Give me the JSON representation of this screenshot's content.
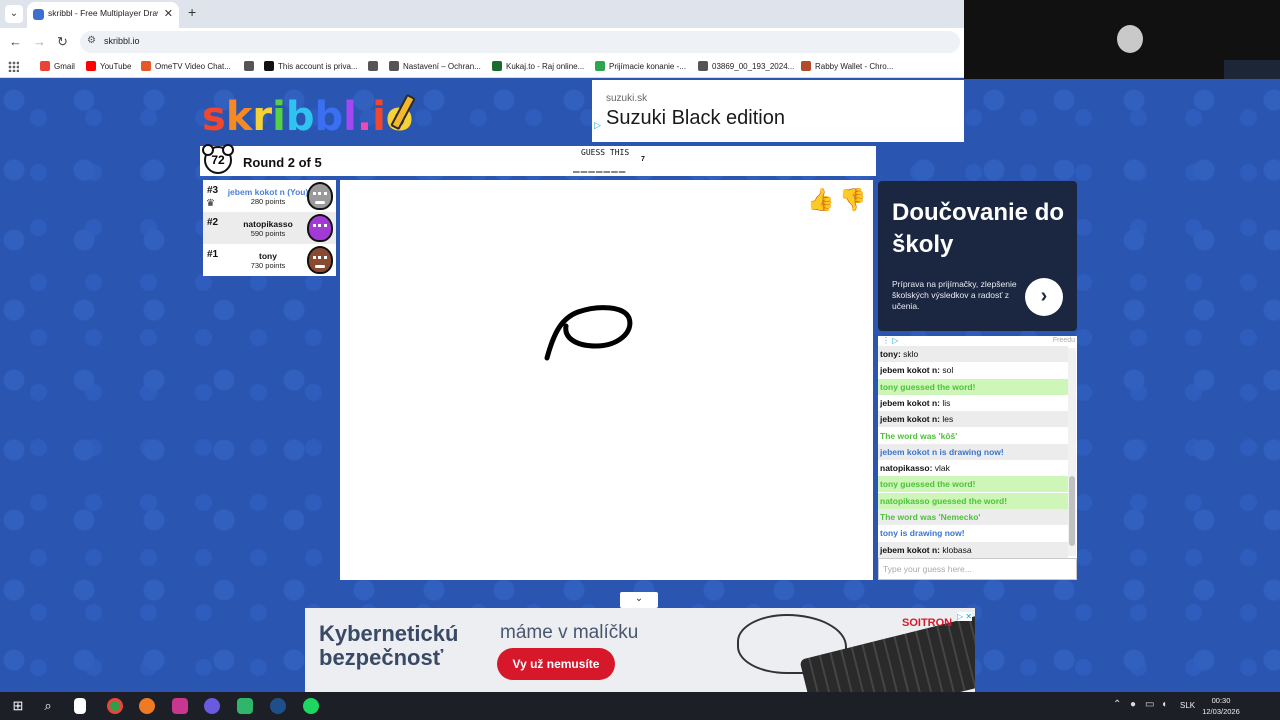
{
  "browser": {
    "tab_title": "skribbl - Free Multiplayer Drawi",
    "url": "skribbl.io",
    "bookmarks": [
      {
        "label": "Gmail",
        "color": "#ea4335"
      },
      {
        "label": "YouTube",
        "color": "#ff0000"
      },
      {
        "label": "OmeTV Video Chat...",
        "color": "#e8572a"
      },
      {
        "label": "",
        "color": "#555555"
      },
      {
        "label": "This account is priva...",
        "color": "#111111"
      },
      {
        "label": "",
        "color": "#555555"
      },
      {
        "label": "Nastavení – Ochran...",
        "color": "#555555"
      },
      {
        "label": "Kukaj.to - Raj online...",
        "color": "#1b6b2f"
      },
      {
        "label": "Prijímacie konanie -...",
        "color": "#2ea44f"
      },
      {
        "label": "03869_00_193_2024...",
        "color": "#555555"
      },
      {
        "label": "Rabby Wallet - Chro...",
        "color": "#b44a2a"
      }
    ]
  },
  "top_ad": {
    "source": "suzuki.sk",
    "headline": "Suzuki Black edition"
  },
  "game": {
    "logo": "skribbl.io",
    "timer": "72",
    "round": "Round 2 of 5",
    "guess_label": "GUESS THIS",
    "word_pattern": "_______",
    "word_length": "7"
  },
  "players": [
    {
      "rank": "#3",
      "name": "jebem kokot n (You)",
      "points": "280 points",
      "avatar_color": "#9a9a9a",
      "is_you": true,
      "crown": "♛"
    },
    {
      "rank": "#2",
      "name": "natopikasso",
      "points": "590 points",
      "avatar_color": "#a33ad6",
      "is_you": false,
      "crown": ""
    },
    {
      "rank": "#1",
      "name": "tony",
      "points": "730 points",
      "avatar_color": "#8a4a32",
      "is_you": false,
      "crown": ""
    }
  ],
  "side_ad": {
    "headline": "Doučovanie do školy",
    "body": "Príprava na prijímačky, zlepšenie školských výsledkov a radosť z učenia.",
    "arrow": "›"
  },
  "ad_strip": {
    "label": "Freedu"
  },
  "chat": {
    "messages": [
      {
        "name": "tony: ",
        "text": "sklo",
        "style": "alt"
      },
      {
        "name": "jebem kokot n: ",
        "text": "sol",
        "style": "plain"
      },
      {
        "name": "",
        "text": "tony guessed the word!",
        "style": "green"
      },
      {
        "name": "jebem kokot n: ",
        "text": "lis",
        "style": "plain"
      },
      {
        "name": "jebem kokot n: ",
        "text": "les",
        "style": "alt"
      },
      {
        "name": "",
        "text": "The word was 'kôš'",
        "style": "greentext"
      },
      {
        "name": "",
        "text": "jebem kokot n is drawing now!",
        "style": "blue-alt"
      },
      {
        "name": "natopikasso: ",
        "text": "vlak",
        "style": "plain"
      },
      {
        "name": "",
        "text": "tony guessed the word!",
        "style": "green"
      },
      {
        "name": "",
        "text": "natopikasso guessed the word!",
        "style": "green"
      },
      {
        "name": "",
        "text": "The word was 'Nemecko'",
        "style": "greentext-alt"
      },
      {
        "name": "",
        "text": "tony is drawing now!",
        "style": "blue"
      },
      {
        "name": "jebem kokot n: ",
        "text": "klobasa",
        "style": "alt"
      }
    ],
    "placeholder": "Type your guess here..."
  },
  "bottom_ad": {
    "headline": "Kybernetickú bezpečnosť",
    "sub": "máme v malíčku",
    "cta": "Vy už nemusíte",
    "brand": "SOITRON"
  },
  "taskbar": {
    "language": "SLK",
    "time": "00:30",
    "date": "12/03/2026"
  }
}
